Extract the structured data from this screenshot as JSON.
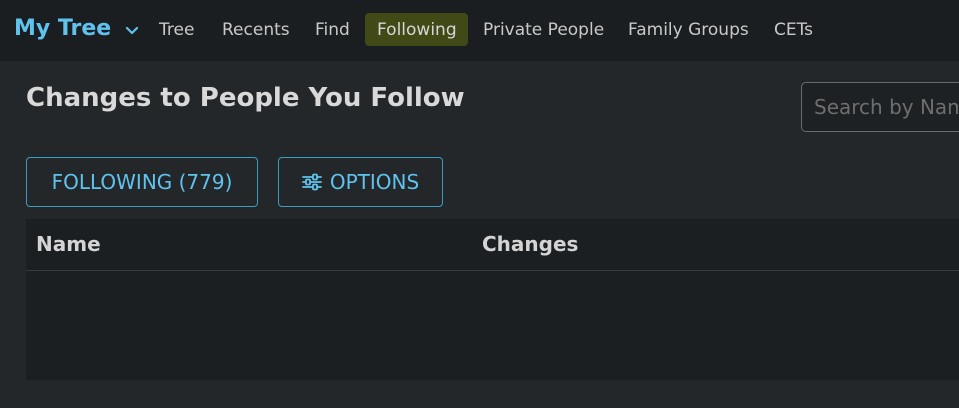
{
  "header": {
    "brand_label": "My Tree",
    "nav": [
      {
        "label": "Tree",
        "active": false
      },
      {
        "label": "Recents",
        "active": false
      },
      {
        "label": "Find",
        "active": false
      },
      {
        "label": "Following",
        "active": true
      },
      {
        "label": "Private People",
        "active": false
      },
      {
        "label": "Family Groups",
        "active": false
      },
      {
        "label": "CETs",
        "active": false
      }
    ]
  },
  "main": {
    "title": "Changes to People You Follow",
    "search_placeholder": "Search by Name",
    "following_button": "FOLLOWING (779)",
    "options_button": "OPTIONS",
    "table": {
      "columns": [
        "Name",
        "Changes"
      ]
    }
  },
  "colors": {
    "accent": "#5fc3ee",
    "active_tab": "#414a17",
    "background": "#232729",
    "topbar": "#1b1e20"
  },
  "icons": {
    "brand_dropdown": "chevron-down-icon",
    "options": "sliders-icon"
  }
}
